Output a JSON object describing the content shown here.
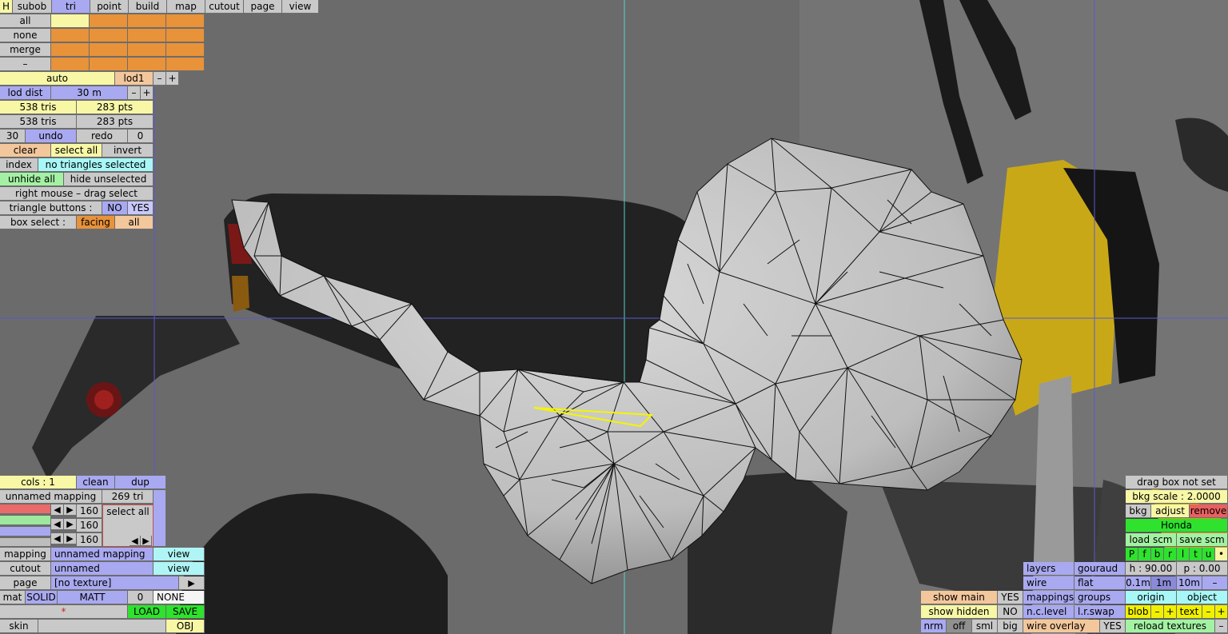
{
  "tabs": {
    "h": "H",
    "subob": "subob",
    "tri": "tri",
    "point": "point",
    "build": "build",
    "map": "map",
    "cutout": "cutout",
    "page": "page",
    "view": "view"
  },
  "select": {
    "all": "all",
    "none": "none",
    "merge": "merge",
    "minus": "–"
  },
  "lod": {
    "auto": "auto",
    "lod1": "lod1",
    "minus": "–",
    "plus": "+",
    "dist_label": "lod dist",
    "dist_value": "30 m"
  },
  "stats": {
    "tris1": "538 tris",
    "pts1": "283 pts",
    "tris2": "538 tris",
    "pts2": "283 pts"
  },
  "history": {
    "undo_count": "30",
    "undo": "undo",
    "redo": "redo",
    "redo_count": "0"
  },
  "selection": {
    "clear": "clear",
    "select_all": "select all",
    "invert": "invert",
    "index": "index",
    "status": "no triangles selected",
    "unhide_all": "unhide all",
    "hide_unselected": "hide unselected",
    "hint": "right mouse – drag select",
    "tri_buttons_label": "triangle buttons :",
    "no": "NO",
    "yes": "YES",
    "box_select_label": "box select :",
    "facing": "facing",
    "all": "all"
  },
  "cols": {
    "label": "cols : 1",
    "clean": "clean",
    "dup": "dup",
    "mapping_name": "unnamed mapping",
    "tri_count": "269 tri",
    "channels": [
      "160",
      "160",
      "160"
    ],
    "select_all": "select all"
  },
  "colors": {
    "red": "#ea6a6a",
    "green": "#9de89d",
    "blue": "#a8a8f0",
    "grey": "#bdbdbd"
  },
  "material": {
    "mapping_label": "mapping",
    "mapping_value": "unnamed mapping",
    "view": "view",
    "cutout_label": "cutout",
    "cutout_value": "unnamed",
    "page_label": "page",
    "page_value": "[no texture]",
    "mat_label": "mat",
    "solid": "SOLID",
    "matt": "MATT",
    "mat_num": "0",
    "mat_none": "NONE",
    "star": "*",
    "load": "LOAD",
    "save": "SAVE",
    "skin_label": "skin",
    "obj": "OBJ",
    "arrow": "▶"
  },
  "bkg": {
    "drag_box": "drag box not set",
    "scale": "bkg scale : 2.0000",
    "bkg": "bkg",
    "adjust": "adjust",
    "remove": "remove",
    "name": "Honda",
    "load_scm": "load scm",
    "save_scm": "save scm",
    "letters": [
      "P",
      "f",
      "b",
      "r",
      "l",
      "t",
      "u",
      "•"
    ],
    "h": "h : 90.00",
    "p": "p : 0.00",
    "steps": [
      "0.1m",
      "1m",
      "10m",
      "–"
    ],
    "origin": "origin",
    "object": "object",
    "blob": "blob",
    "text": "text",
    "reload": "reload textures",
    "minus": "–",
    "plus": "+"
  },
  "display": {
    "layers": "layers",
    "gouraud": "gouraud",
    "wire": "wire",
    "flat": "flat",
    "mappings": "mappings",
    "groups": "groups",
    "nclevel": "n.c.level",
    "lrswap": "l.r.swap",
    "wire_overlay": "wire overlay",
    "yes": "YES",
    "show_main": "show main",
    "show_main_val": "YES",
    "show_hidden": "show hidden",
    "show_hidden_val": "NO",
    "nrm": "nrm",
    "off": "off",
    "sml": "sml",
    "big": "big"
  }
}
